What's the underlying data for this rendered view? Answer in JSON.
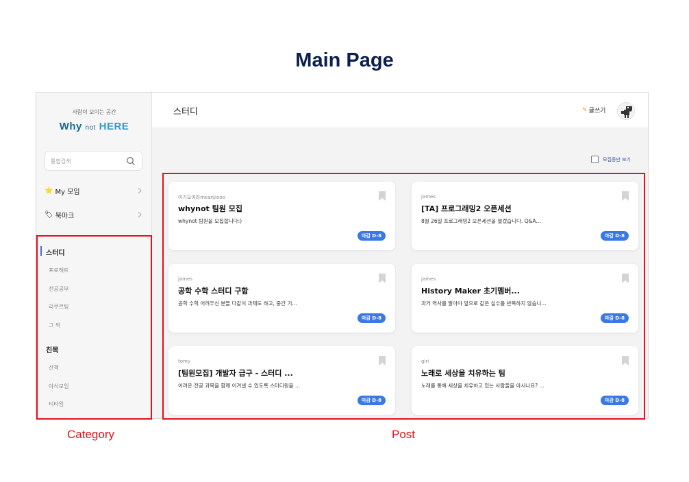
{
  "heading": "Main Page",
  "sidebar": {
    "tagline": "사람이 모이는 공간",
    "logo": {
      "part1": "Why",
      "part2": "not",
      "part3": "HERE"
    },
    "search": {
      "placeholder": "통합검색",
      "value": ""
    },
    "menu": [
      {
        "icon": "star-icon",
        "glyph": "⭐",
        "label": "My 모임"
      },
      {
        "icon": "bookmark-tag-icon",
        "glyph": "🏷",
        "label": "북마크"
      }
    ],
    "categories": [
      {
        "title": "스터디",
        "items": [
          "프로젝트",
          "전공공부",
          "리쿠르팅",
          "그 외"
        ]
      },
      {
        "title": "친목",
        "items": [
          "산책",
          "야식모임",
          "티타임"
        ]
      }
    ]
  },
  "main": {
    "board_title": "스터디",
    "write_label": "글쓰기",
    "filter_label": "모집중만 보기",
    "posts": [
      {
        "author": "여기모여라meanjiooo",
        "title": "whynot 팀원 모집",
        "desc": "whynot 팀원을 모집합니다:)",
        "badge": "마감 D-8"
      },
      {
        "author": "james",
        "title": "[TA] 프로그래밍2 오픈세션",
        "desc": "8월 26일 프로그래밍2 오픈세션을 열겠습니다. Q&A...",
        "badge": "마감 D-8"
      },
      {
        "author": "james",
        "title": "공학 수학 스터디 구함",
        "desc": "공학 수학 어려우신 분들 다같이 과제도 하고, 중간 기...",
        "badge": "마감 D-8"
      },
      {
        "author": "james",
        "title": "History Maker 초기멤버...",
        "desc": "과거 역사를 말아야 앞으로 같은 실수를 반복하지 않습니...",
        "badge": "마감 D-8"
      },
      {
        "author": "tomy",
        "title": "[팀원모집] 개발자 급구 - 스터디 ...",
        "desc": "어려운 전공 과목을 함께 이겨낼 수 있도록 스터디원을 ...",
        "badge": "마감 D-8"
      },
      {
        "author": "giri",
        "title": "노래로 세상을 치유하는 팀",
        "desc": "노래를 통해 세상을 치유하고 있는 사람들을 아시나요? ...",
        "badge": "마감 D-8"
      }
    ]
  },
  "annotations": {
    "category": "Category",
    "post": "Post"
  },
  "colors": {
    "accent": "#3b78e7",
    "outline": "#e60f1a",
    "heading": "#0c1f4d"
  }
}
